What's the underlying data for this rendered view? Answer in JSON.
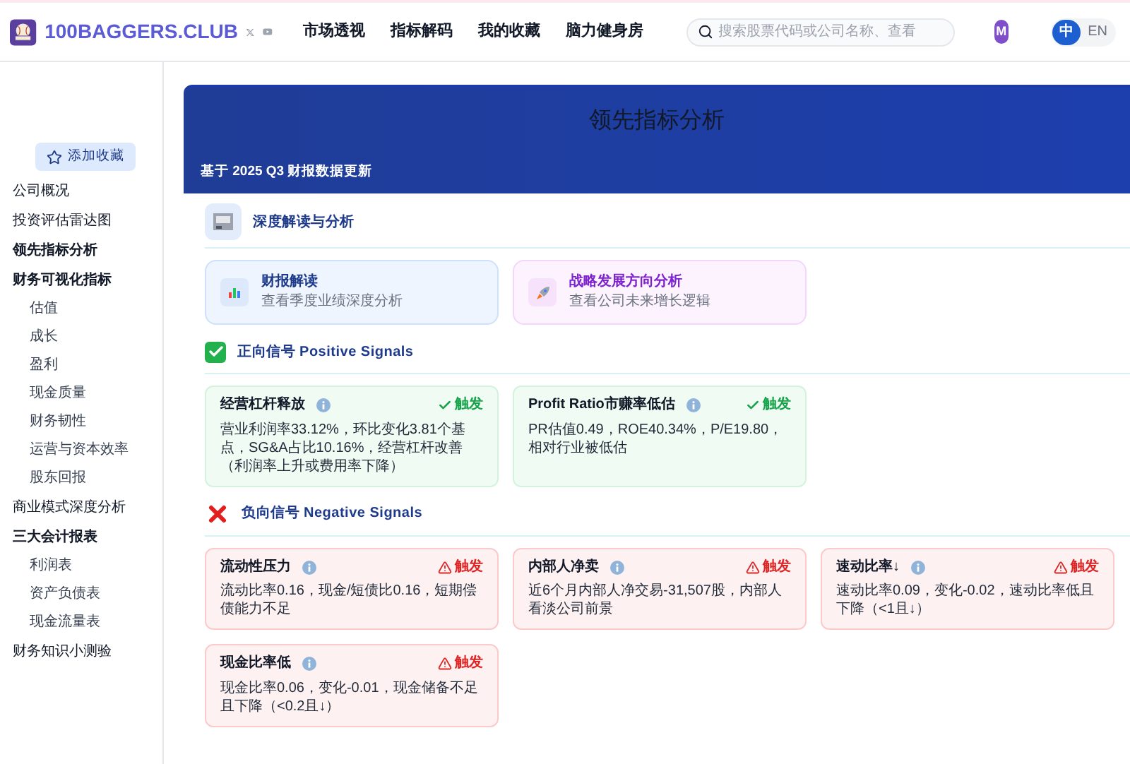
{
  "header": {
    "brand": "100BAGGERS.CLUB",
    "nav": [
      {
        "label": "市场透视"
      },
      {
        "label": "指标解码"
      },
      {
        "label": "我的收藏"
      },
      {
        "label": "脑力健身房"
      }
    ],
    "search": {
      "placeholder": "搜索股票代码或公司名称、查看"
    },
    "avatar": "M",
    "languages": [
      {
        "label": "中",
        "selected": true
      },
      {
        "label": "EN",
        "selected": false
      }
    ]
  },
  "sidebar": {
    "favorite_button": "添加收藏",
    "items": [
      {
        "label": "公司概况",
        "kind": "link",
        "selected": false
      },
      {
        "label": "投资评估雷达图",
        "kind": "link",
        "selected": false
      },
      {
        "label": "领先指标分析",
        "kind": "link",
        "selected": true
      },
      {
        "label": "财务可视化指标",
        "kind": "group",
        "children": [
          {
            "label": "估值",
            "selected": false
          },
          {
            "label": "成长",
            "selected": false
          },
          {
            "label": "盈利",
            "selected": false
          },
          {
            "label": "现金质量",
            "selected": false
          },
          {
            "label": "财务韧性",
            "selected": false
          },
          {
            "label": "运营与资本效率",
            "selected": false
          },
          {
            "label": "股东回报",
            "selected": false
          }
        ]
      },
      {
        "label": "商业模式深度分析",
        "kind": "link",
        "selected": false
      },
      {
        "label": "三大会计报表",
        "kind": "group",
        "children": [
          {
            "label": "利润表",
            "selected": false
          },
          {
            "label": "资产负债表",
            "selected": false
          },
          {
            "label": "现金流量表",
            "selected": false
          }
        ]
      },
      {
        "label": "财务知识小测验",
        "kind": "link",
        "selected": false
      }
    ]
  },
  "banner": {
    "title": "领先指标分析",
    "subtitle": "基于 2025 Q3 财报数据更新"
  },
  "sections": [
    {
      "kind": "analysis",
      "title": "深度解读与分析",
      "cards": [
        {
          "kind": "report",
          "title": "财报解读",
          "description": "查看季度业绩深度分析"
        },
        {
          "kind": "strategy",
          "title": "战略发展方向分析",
          "description": "查看公司未来增长逻辑"
        }
      ]
    },
    {
      "kind": "positive",
      "title": "正向信号 Positive Signals",
      "cards": [
        {
          "title": "经营杠杆释放",
          "status": "触发",
          "description": "营业利润率33.12%，环比变化3.81个基点，SG&A占比10.16%，经营杠杆改善（利润率上升或费用率下降）"
        },
        {
          "title": "Profit Ratio市赚率低估",
          "status": "触发",
          "description": "PR估值0.49，ROE40.34%，P/E19.80，相对行业被低估"
        }
      ]
    },
    {
      "kind": "negative",
      "title": "负向信号 Negative Signals",
      "cards": [
        {
          "title": "流动性压力",
          "status": "触发",
          "description": "流动比率0.16，现金/短债比0.16，短期偿债能力不足"
        },
        {
          "title": "内部人净卖",
          "status": "触发",
          "description": "近6个月内部人净交易-31,507股，内部人看淡公司前景"
        },
        {
          "title": "速动比率↓",
          "status": "触发",
          "description": "速动比率0.09，变化-0.02，速动比率低且下降（<1且↓）"
        },
        {
          "title": "现金比率低",
          "status": "触发",
          "description": "现金比率0.06，变化-0.01，现金储备不足且下降（<0.2且↓）"
        }
      ]
    }
  ]
}
